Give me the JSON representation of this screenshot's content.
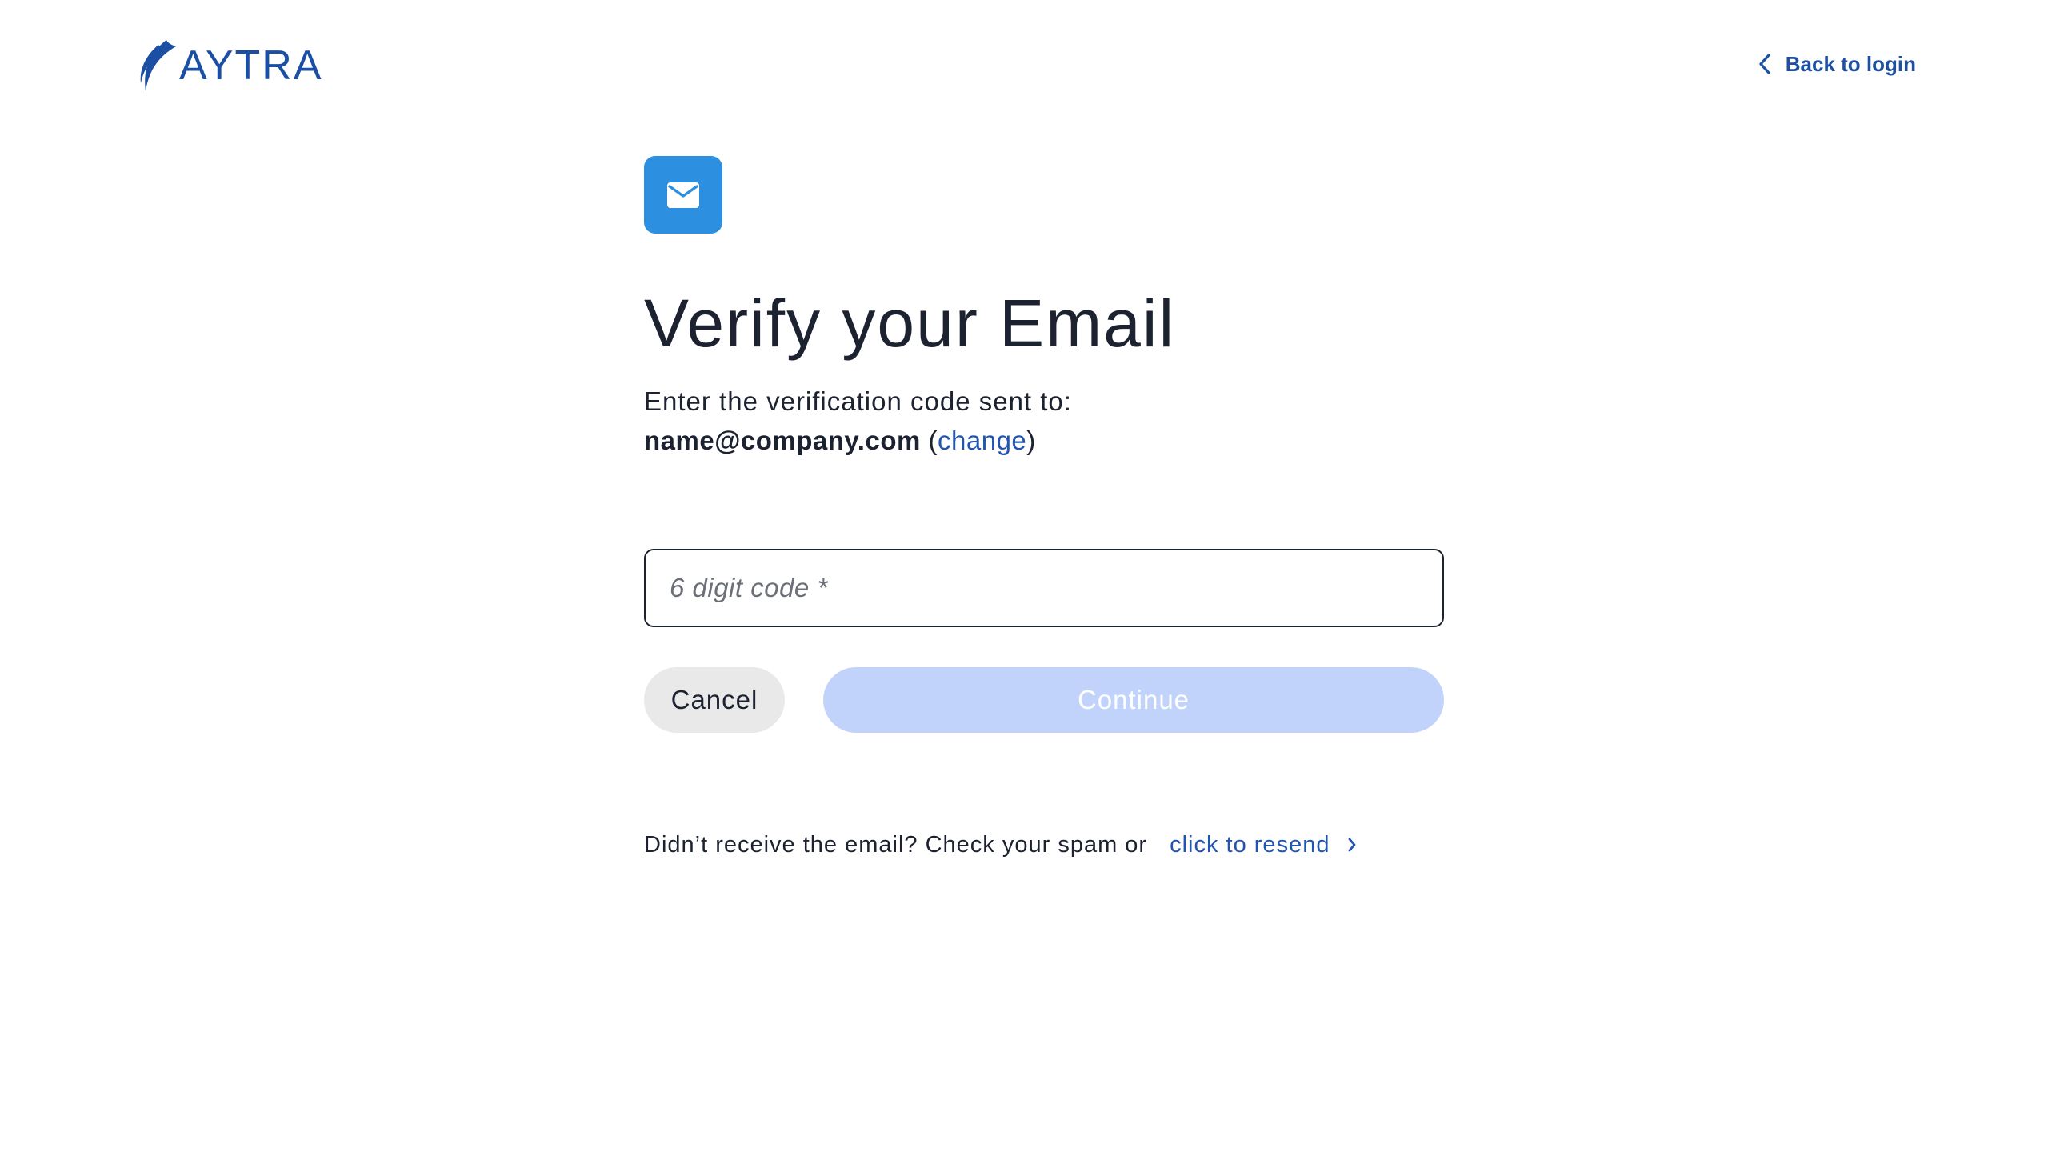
{
  "brand": {
    "name": "AYTRA",
    "color": "#1a4fa3"
  },
  "header": {
    "back_label": "Back to login",
    "back_icon": "chevron-left-icon"
  },
  "main": {
    "badge_icon": "mail-icon",
    "badge_color": "#2d8fdf",
    "title": "Verify your Email",
    "subtitle": "Enter the verification code sent to:",
    "email": "name@company.com",
    "change_open": " (",
    "change_label": "change",
    "change_close": ")",
    "code_placeholder": "6 digit code *",
    "cancel_label": "Cancel",
    "continue_label": "Continue",
    "resend_prompt": "Didn’t receive the email? Check your spam or",
    "resend_label": "click to resend",
    "resend_icon": "chevron-right-icon"
  },
  "colors": {
    "link": "#2155b0",
    "continue_disabled": "#c2d3fb",
    "cancel_bg": "#e9e9ea"
  }
}
